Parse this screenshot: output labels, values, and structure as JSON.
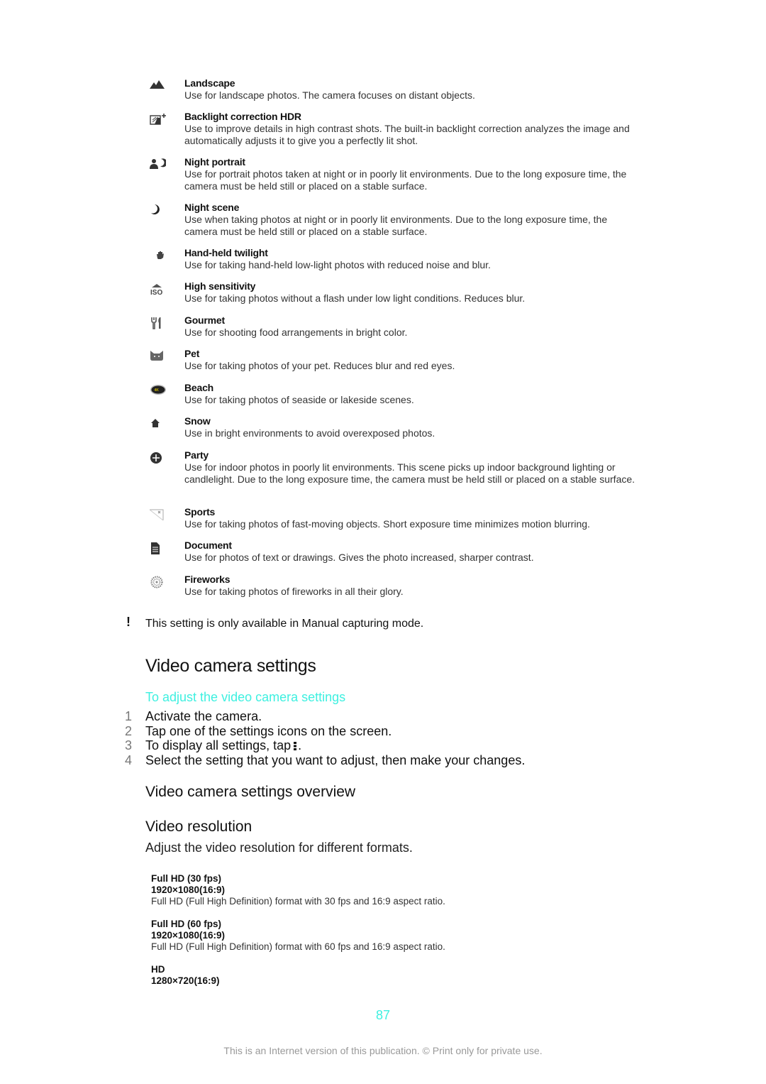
{
  "scenes": [
    {
      "icon": "landscape-icon",
      "title": "Landscape",
      "desc": "Use for landscape photos. The camera focuses on distant objects."
    },
    {
      "icon": "backlight-hdr-icon",
      "title": "Backlight correction HDR",
      "desc": "Use to improve details in high contrast shots. The built-in backlight correction analyzes the image and automatically adjusts it to give you a perfectly lit shot."
    },
    {
      "icon": "night-portrait-icon",
      "title": "Night portrait",
      "desc": "Use for portrait photos taken at night or in poorly lit environments. Due to the long exposure time, the camera must be held still or placed on a stable surface."
    },
    {
      "icon": "night-scene-icon",
      "title": "Night scene",
      "desc": "Use when taking photos at night or in poorly lit environments. Due to the long exposure time, the camera must be held still or placed on a stable surface."
    },
    {
      "icon": "hand-held-twilight-icon",
      "title": "Hand-held twilight",
      "desc": "Use for taking hand-held low-light photos with reduced noise and blur."
    },
    {
      "icon": "high-sensitivity-iso-icon",
      "title": "High sensitivity",
      "desc": "Use for taking photos without a flash under low light conditions. Reduces blur."
    },
    {
      "icon": "gourmet-icon",
      "title": "Gourmet",
      "desc": "Use for shooting food arrangements in bright color."
    },
    {
      "icon": "pet-icon",
      "title": "Pet",
      "desc": "Use for taking photos of your pet. Reduces blur and red eyes."
    },
    {
      "icon": "beach-icon",
      "title": "Beach",
      "desc": "Use for taking photos of seaside or lakeside scenes."
    },
    {
      "icon": "snow-icon",
      "title": "Snow",
      "desc": "Use in bright environments to avoid overexposed photos."
    },
    {
      "icon": "party-icon",
      "title": "Party",
      "desc": "Use for indoor photos in poorly lit environments. This scene picks up indoor background lighting or candlelight. Due to the long exposure time, the camera must be held still or placed on a stable surface."
    },
    {
      "icon": "sports-icon",
      "title": "Sports",
      "desc": "Use for taking photos of fast-moving objects. Short exposure time minimizes motion blurring."
    },
    {
      "icon": "document-icon",
      "title": "Document",
      "desc": "Use for photos of text or drawings. Gives the photo increased, sharper contrast."
    },
    {
      "icon": "fireworks-icon",
      "title": "Fireworks",
      "desc": "Use for taking photos of fireworks in all their glory."
    }
  ],
  "note": {
    "icon": "exclamation-icon",
    "text": "This setting is only available in Manual capturing mode."
  },
  "section": {
    "title": "Video camera settings",
    "subheading": "To adjust the video camera settings",
    "steps": [
      {
        "num": "1",
        "text": "Activate the camera."
      },
      {
        "num": "2",
        "text": "Tap one of the settings icons on the screen."
      },
      {
        "num": "3",
        "text": "To display all settings, tap",
        "suffix": ".",
        "icon": "menu-more-icon"
      },
      {
        "num": "4",
        "text": "Select the setting that you want to adjust, then make your changes."
      }
    ]
  },
  "overview": {
    "title": "Video camera settings overview"
  },
  "resolution": {
    "title": "Video resolution",
    "lead": "Adjust the video resolution for different formats.",
    "options": [
      {
        "name": "Full HD (30 fps)",
        "dim": "1920×1080(16:9)",
        "desc": "Full HD (Full High Definition) format with 30 fps and 16:9 aspect ratio."
      },
      {
        "name": "Full HD (60 fps)",
        "dim": "1920×1080(16:9)",
        "desc": "Full HD (Full High Definition) format with 60 fps and 16:9 aspect ratio."
      },
      {
        "name": "HD",
        "dim": "1280×720(16:9)",
        "desc": ""
      }
    ]
  },
  "page_number": "87",
  "footer": "This is an Internet version of this publication. © Print only for private use.",
  "colors": {
    "accent": "#3ef0e0",
    "text": "#111111",
    "muted": "#999999"
  }
}
